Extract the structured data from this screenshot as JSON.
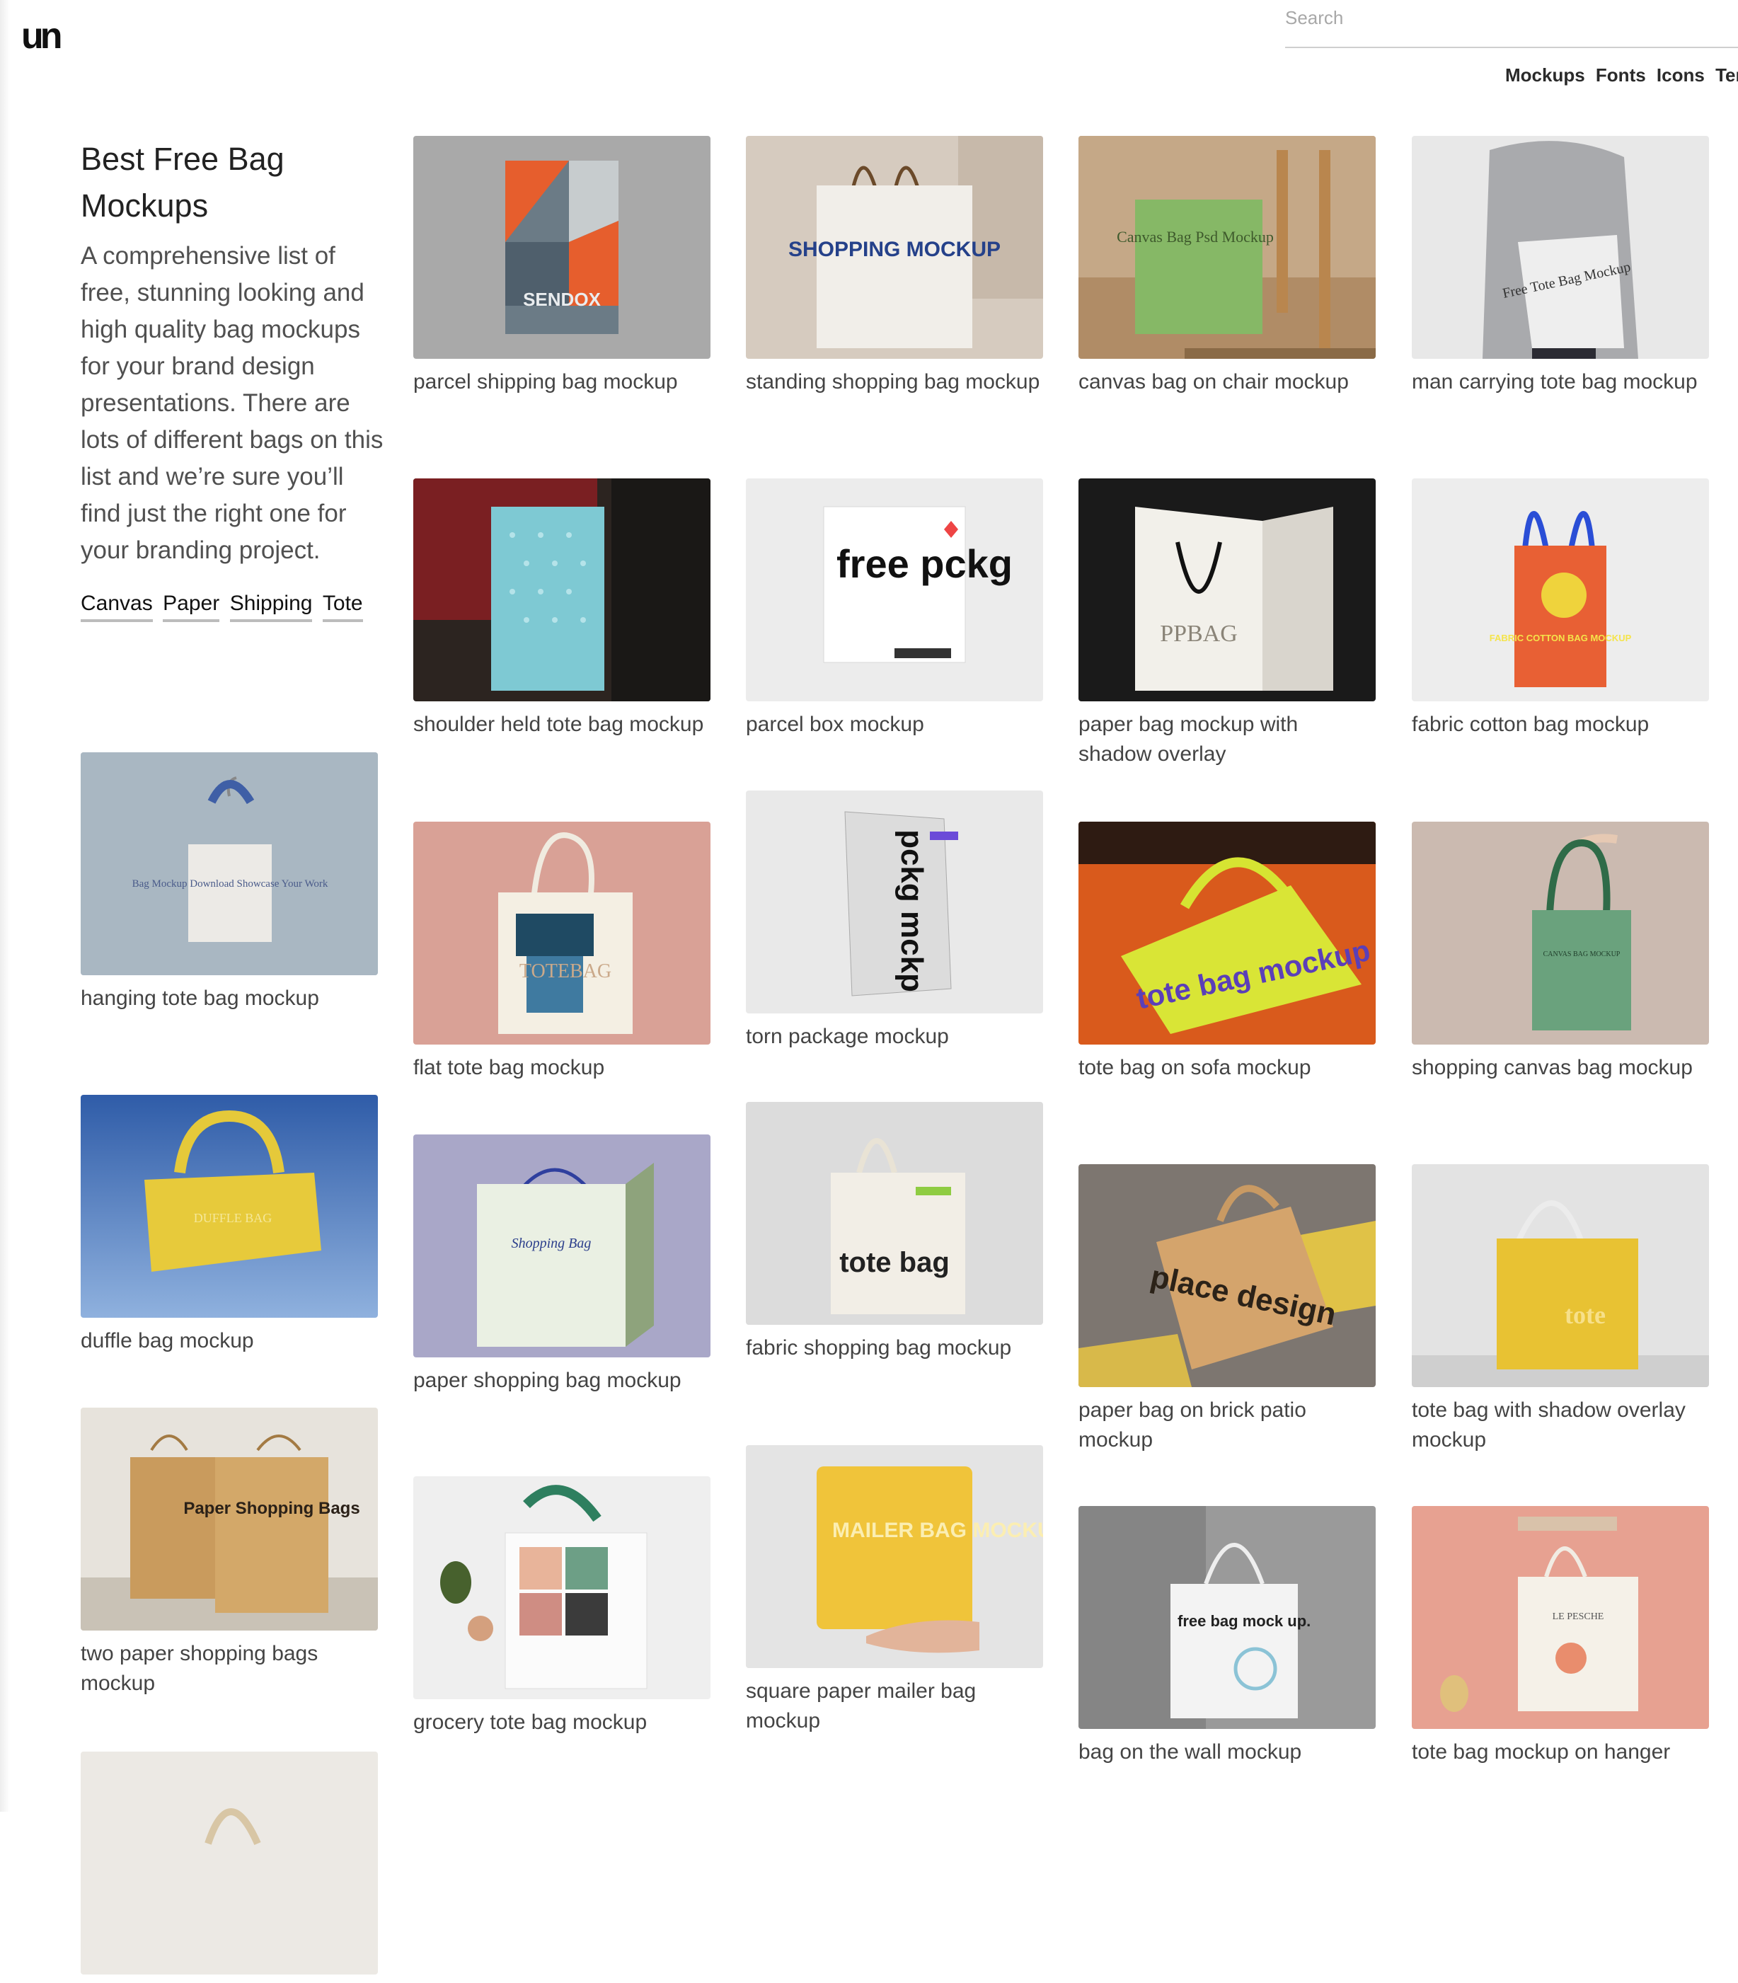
{
  "logo": {
    "text": "un"
  },
  "search": {
    "placeholder": "Search"
  },
  "nav": {
    "items": [
      "Mockups",
      "Fonts",
      "Icons",
      "Tem"
    ]
  },
  "intro": {
    "title": "Best Free Bag Mockups",
    "description": "A comprehensive list of free, stunning looking and high quality bag mockups for your brand design presentations. There are lots of different bags on this list and we’re sure you’ll find just the right one for your branding project.",
    "tags": [
      "Canvas",
      "Paper",
      "Shipping",
      "Tote"
    ]
  },
  "cards": [
    {
      "caption": "hanging tote bag mockup",
      "thumb_text": "Bag Mockup Download Showcase Your Work"
    },
    {
      "caption": "duffle bag mockup",
      "thumb_text": "DUFFLE BAG"
    },
    {
      "caption": "two paper shopping bags mockup",
      "thumb_text": "Paper Shopping Bags"
    },
    {
      "caption": "parcel shipping bag mockup",
      "thumb_text": "SENDOX"
    },
    {
      "caption": "shoulder held tote bag mockup",
      "thumb_text": ""
    },
    {
      "caption": "flat tote bag mockup",
      "thumb_text": "TOTEBAG"
    },
    {
      "caption": "paper shopping bag mockup",
      "thumb_text": "Shopping Bag"
    },
    {
      "caption": "grocery tote bag mockup",
      "thumb_text": ""
    },
    {
      "caption": "standing shopping bag mockup",
      "thumb_text": "SHOPPING MOCKUP"
    },
    {
      "caption": "parcel box mockup",
      "thumb_text": "free pckg"
    },
    {
      "caption": "torn package mockup",
      "thumb_text": "pckg mckp"
    },
    {
      "caption": "fabric shopping bag mockup",
      "thumb_text": "tote bag"
    },
    {
      "caption": "square paper mailer bag mockup",
      "thumb_text": "MAILER BAG MOCKUP"
    },
    {
      "caption": "canvas bag on chair mockup",
      "thumb_text": "Canvas Bag Psd Mockup"
    },
    {
      "caption": "paper bag mockup with shadow overlay",
      "thumb_text": "PPBAG"
    },
    {
      "caption": "tote bag on sofa mockup",
      "thumb_text": "tote bag mockup"
    },
    {
      "caption": "paper bag on brick patio mockup",
      "thumb_text": "place design"
    },
    {
      "caption": "bag on the wall mockup",
      "thumb_text": "free bag mock up."
    },
    {
      "caption": "man carrying tote bag mockup",
      "thumb_text": "Free Tote Bag Mockup"
    },
    {
      "caption": "fabric cotton bag mockup",
      "thumb_text": "FABRIC COTTON BAG MOCKUP"
    },
    {
      "caption": "shopping canvas bag mockup",
      "thumb_text": "CANVAS BAG MOCKUP"
    },
    {
      "caption": "tote bag with shadow overlay mockup",
      "thumb_text": "tote"
    },
    {
      "caption": "tote bag mockup on hanger",
      "thumb_text": "LE PESCHE"
    },
    {
      "caption": "",
      "thumb_text": ""
    }
  ]
}
